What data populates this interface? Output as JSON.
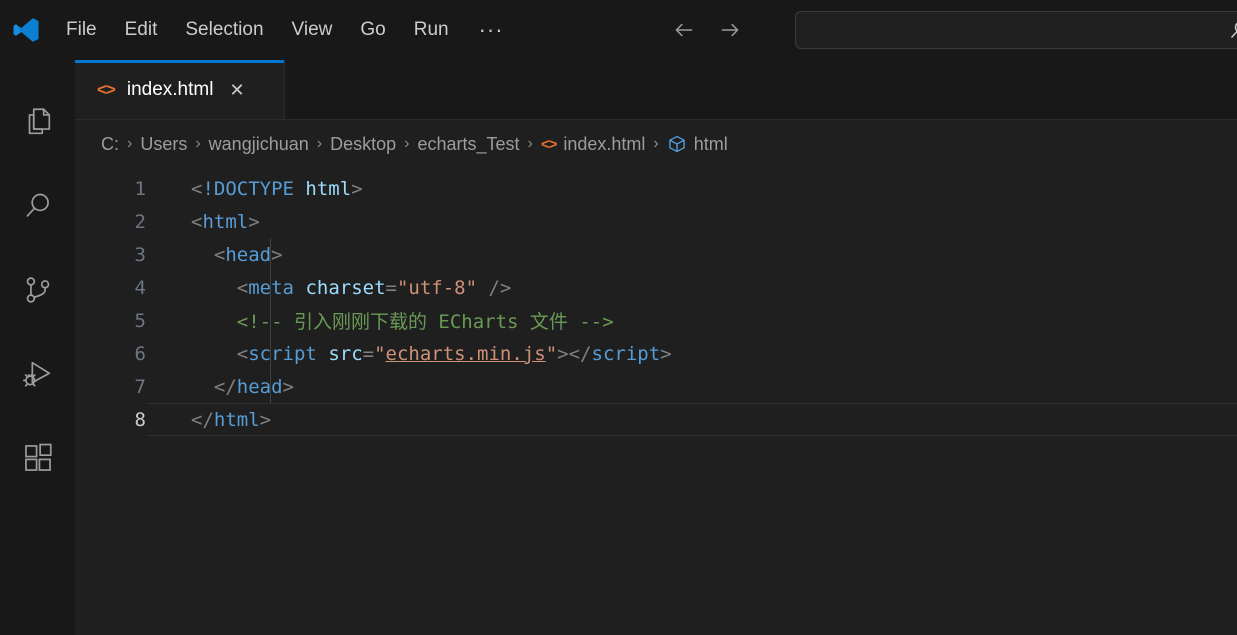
{
  "app": {
    "name": "Visual Studio Code",
    "logo_icon": "vscode-logo-icon"
  },
  "titlebar": {
    "menus": [
      {
        "label": "File",
        "name": "menu-file"
      },
      {
        "label": "Edit",
        "name": "menu-edit"
      },
      {
        "label": "Selection",
        "name": "menu-selection"
      },
      {
        "label": "View",
        "name": "menu-view"
      },
      {
        "label": "Go",
        "name": "menu-go"
      },
      {
        "label": "Run",
        "name": "menu-run"
      },
      {
        "label": "···",
        "name": "menu-more"
      }
    ],
    "nav": {
      "back_icon": "arrow-left-icon",
      "forward_icon": "arrow-right-icon"
    },
    "search": {
      "value": "",
      "placeholder": "",
      "icon": "search-icon"
    }
  },
  "activitybar": {
    "items": [
      {
        "name": "activity-explorer",
        "icon": "files-icon",
        "title": "Explorer"
      },
      {
        "name": "activity-search",
        "icon": "search-icon",
        "title": "Search"
      },
      {
        "name": "activity-source-control",
        "icon": "source-control-icon",
        "title": "Source Control"
      },
      {
        "name": "activity-run-debug",
        "icon": "run-debug-icon",
        "title": "Run and Debug"
      },
      {
        "name": "activity-extensions",
        "icon": "extensions-icon",
        "title": "Extensions"
      }
    ]
  },
  "editor": {
    "tabs": [
      {
        "label": "index.html",
        "icon": "html-file-icon",
        "close_label": "✕",
        "active": true
      }
    ],
    "breadcrumb": {
      "separator": "›",
      "items": [
        {
          "label": "C:",
          "icon": null
        },
        {
          "label": "Users",
          "icon": null
        },
        {
          "label": "wangjichuan",
          "icon": null
        },
        {
          "label": "Desktop",
          "icon": null
        },
        {
          "label": "echarts_Test",
          "icon": null
        },
        {
          "label": "index.html",
          "icon": "html-file-icon"
        },
        {
          "label": "html",
          "icon": "symbol-structure-icon"
        }
      ]
    },
    "active_line": 8,
    "lines": [
      {
        "number": "1",
        "indent": 0,
        "tokens": [
          {
            "t": "<",
            "c": "s-punct"
          },
          {
            "t": "!DOCTYPE",
            "c": "s-doctype"
          },
          {
            "t": " ",
            "c": "s-punct"
          },
          {
            "t": "html",
            "c": "s-attr"
          },
          {
            "t": ">",
            "c": "s-punct"
          }
        ]
      },
      {
        "number": "2",
        "indent": 0,
        "tokens": [
          {
            "t": "<",
            "c": "s-punct"
          },
          {
            "t": "html",
            "c": "s-tag"
          },
          {
            "t": ">",
            "c": "s-punct"
          }
        ]
      },
      {
        "number": "3",
        "indent": 1,
        "tokens": [
          {
            "t": "<",
            "c": "s-punct"
          },
          {
            "t": "head",
            "c": "s-tag"
          },
          {
            "t": ">",
            "c": "s-punct"
          }
        ]
      },
      {
        "number": "4",
        "indent": 2,
        "tokens": [
          {
            "t": "<",
            "c": "s-punct"
          },
          {
            "t": "meta",
            "c": "s-tag"
          },
          {
            "t": " ",
            "c": "s-punct"
          },
          {
            "t": "charset",
            "c": "s-attr"
          },
          {
            "t": "=",
            "c": "s-eq"
          },
          {
            "t": "\"utf-8\"",
            "c": "s-string"
          },
          {
            "t": " />",
            "c": "s-punct"
          }
        ]
      },
      {
        "number": "5",
        "indent": 2,
        "tokens": [
          {
            "t": "<!-- 引入刚刚下载的 ECharts 文件 -->",
            "c": "s-comment"
          }
        ]
      },
      {
        "number": "6",
        "indent": 2,
        "tokens": [
          {
            "t": "<",
            "c": "s-punct"
          },
          {
            "t": "script",
            "c": "s-tag"
          },
          {
            "t": " ",
            "c": "s-punct"
          },
          {
            "t": "src",
            "c": "s-attr"
          },
          {
            "t": "=",
            "c": "s-eq"
          },
          {
            "t": "\"",
            "c": "s-string"
          },
          {
            "t": "echarts.min.js",
            "c": "s-link"
          },
          {
            "t": "\"",
            "c": "s-string"
          },
          {
            "t": ">",
            "c": "s-punct"
          },
          {
            "t": "</",
            "c": "s-punct"
          },
          {
            "t": "script",
            "c": "s-tag"
          },
          {
            "t": ">",
            "c": "s-punct"
          }
        ]
      },
      {
        "number": "7",
        "indent": 1,
        "tokens": [
          {
            "t": "</",
            "c": "s-punct"
          },
          {
            "t": "head",
            "c": "s-tag"
          },
          {
            "t": ">",
            "c": "s-punct"
          }
        ]
      },
      {
        "number": "8",
        "indent": 0,
        "tokens": [
          {
            "t": "</",
            "c": "s-punct"
          },
          {
            "t": "html",
            "c": "s-tag"
          },
          {
            "t": ">",
            "c": "s-punct"
          }
        ]
      }
    ]
  },
  "colors": {
    "titlebar_bg": "#181818",
    "editor_bg": "#1f1f1f",
    "tab_active_border": "#0078d4",
    "accent_orange": "#e8712f",
    "tag_blue": "#569cd6",
    "attr_blue": "#9cdcfe",
    "string_orange": "#ce9178",
    "comment_green": "#6a9955",
    "foreground": "#cccccc"
  }
}
